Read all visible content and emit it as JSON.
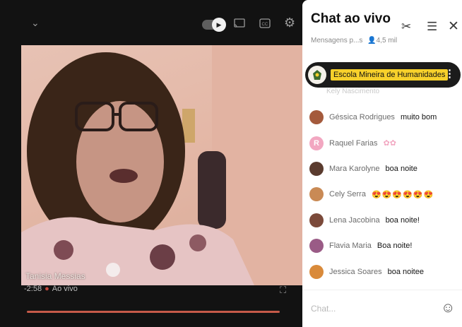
{
  "video": {
    "person_name": "Tanisia Messias",
    "time": "-2:58",
    "live_label": "Ao vivo",
    "icons": [
      "chevron-down-icon",
      "autoplay-toggle-icon",
      "cast-icon",
      "captions-icon",
      "settings-icon",
      "fullscreen-icon"
    ],
    "progress_fraction": 1.0,
    "colors": {
      "accent": "#c65a49",
      "background": "#121212"
    }
  },
  "chat": {
    "title": "Chat ao vivo",
    "subtitle": "Mensagens p...s",
    "viewers": "4,5 mil",
    "header_icons": [
      "scissors-icon",
      "tune-icon",
      "close-icon"
    ],
    "pinned": {
      "name": "Escola Mineira de Humanidades",
      "more": "⋮"
    },
    "peek_text": "Kely Nascimento",
    "messages": [
      {
        "author": "Géssica Rodrigues",
        "text": "muito bom",
        "avatar_color": "#a45a3c"
      },
      {
        "author": "Raquel Farias",
        "text": "✿✿",
        "avatar_initial": "R",
        "avatar_color": "#f2a7c1"
      },
      {
        "author": "Mara Karolyne",
        "text": "boa noite",
        "avatar_color": "#5a3b2e"
      },
      {
        "author": "Cely Serra",
        "text": "😍😍😍😍😍😍",
        "avatar_color": "#c98a55"
      },
      {
        "author": "Lena Jacobina",
        "text": "boa noite!",
        "avatar_color": "#7b4a3a"
      },
      {
        "author": "Flavia Maria",
        "text": "Boa noite!",
        "avatar_color": "#9a5b86"
      },
      {
        "author": "Jessica Soares",
        "text": "boa noitee",
        "avatar_color": "#d98a3a"
      }
    ],
    "input_placeholder": "Chat...",
    "accent_color": "#f7d02b"
  }
}
